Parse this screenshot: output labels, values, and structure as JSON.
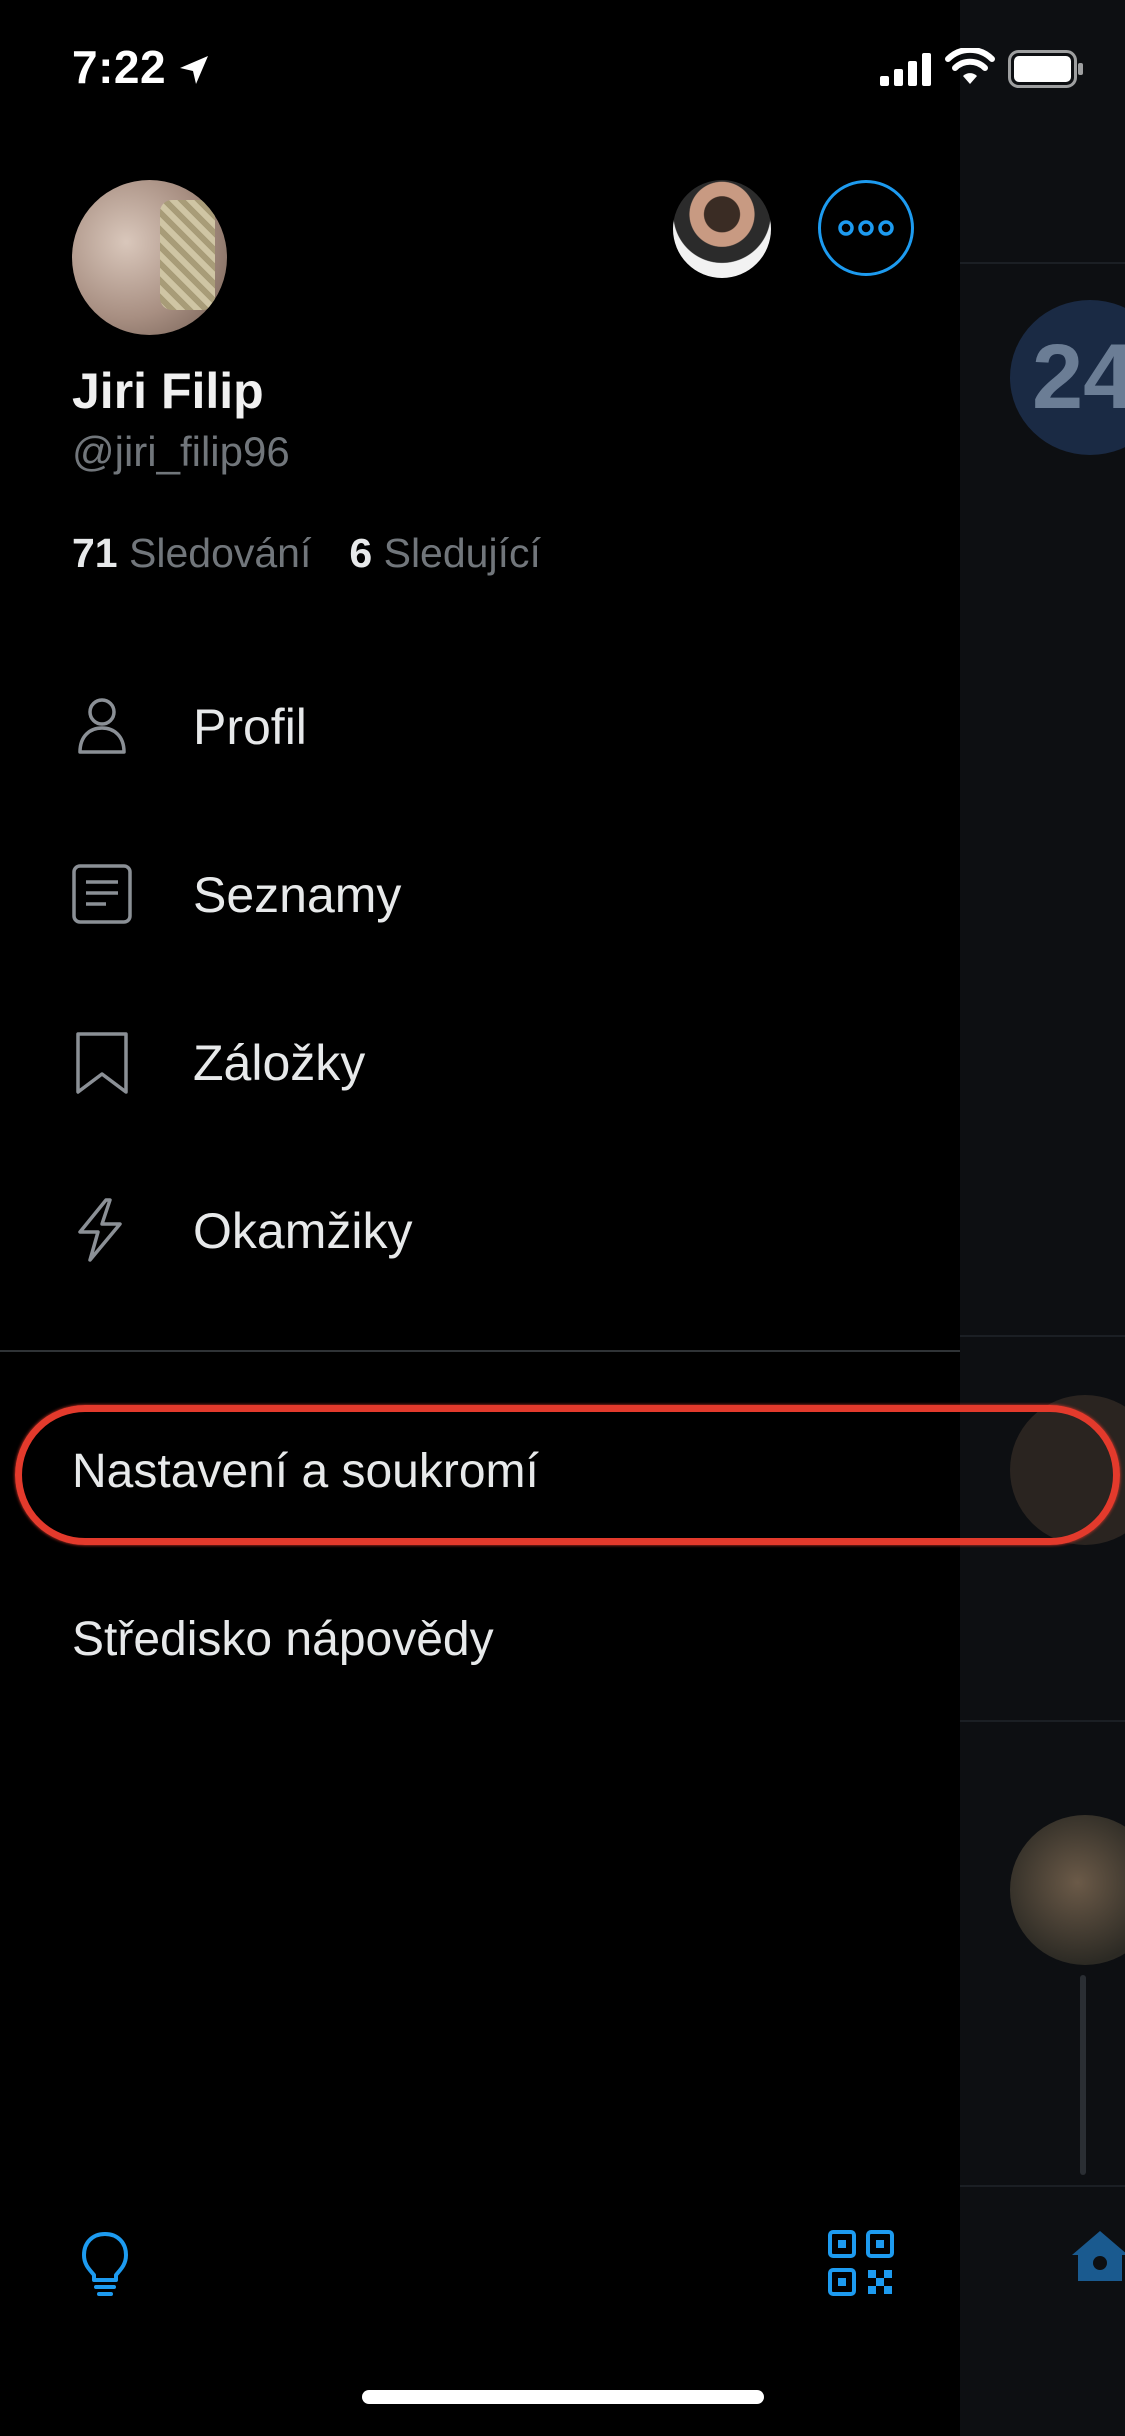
{
  "status_bar": {
    "time": "7:22"
  },
  "profile": {
    "display_name": "Jiri Filip",
    "handle": "@jiri_filip96",
    "following_count": "71",
    "following_label": "Sledování",
    "followers_count": "6",
    "followers_label": "Sledující"
  },
  "menu": {
    "items": [
      {
        "label": "Profil",
        "icon": "person-icon"
      },
      {
        "label": "Seznamy",
        "icon": "list-icon"
      },
      {
        "label": "Záložky",
        "icon": "bookmark-icon"
      },
      {
        "label": "Okamžiky",
        "icon": "lightning-icon"
      }
    ],
    "links": [
      {
        "label": "Nastavení a soukromí"
      },
      {
        "label": "Středisko nápovědy"
      }
    ]
  },
  "timeline_peek": {
    "badge_text": "24"
  },
  "colors": {
    "accent": "#1d9bf0",
    "annotation": "#e33a2c",
    "background": "#000000",
    "muted_text": "#71767b"
  },
  "bottom_bar": {
    "left_icon": "lightbulb-icon",
    "right_icon": "qr-code-icon"
  }
}
